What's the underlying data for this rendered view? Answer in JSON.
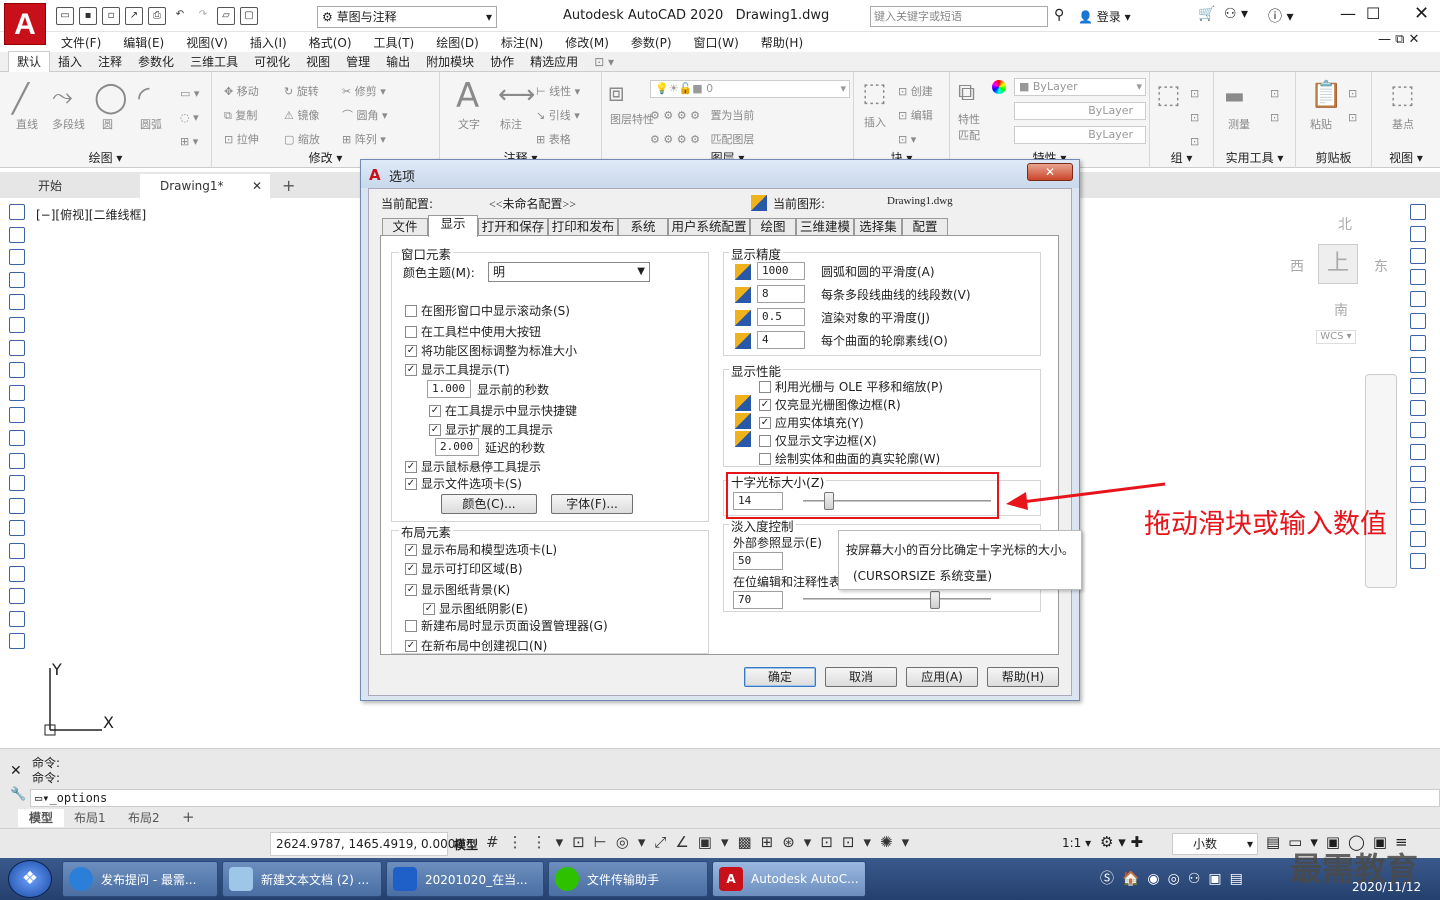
{
  "app": {
    "title": "Autodesk AutoCAD 2020",
    "doc": "Drawing1.dwg",
    "workspace": "草图与注释",
    "search_placeholder": "键入关键字或短语",
    "login": "登录"
  },
  "menu": [
    "文件(F)",
    "编辑(E)",
    "视图(V)",
    "插入(I)",
    "格式(O)",
    "工具(T)",
    "绘图(D)",
    "标注(N)",
    "修改(M)",
    "参数(P)",
    "窗口(W)",
    "帮助(H)"
  ],
  "ribbon_tabs": [
    "默认",
    "插入",
    "注释",
    "参数化",
    "三维工具",
    "可视化",
    "视图",
    "管理",
    "输出",
    "附加模块",
    "协作",
    "精选应用"
  ],
  "ribbon": {
    "draw_items": [
      "直线",
      "多段线",
      "圆",
      "圆弧"
    ],
    "modify_items": [
      "移动",
      "旋转",
      "修剪",
      "复制",
      "镜像",
      "圆角",
      "拉伸",
      "缩放",
      "阵列"
    ],
    "annot_items": [
      "文字",
      "标注",
      "线性",
      "引线",
      "表格"
    ],
    "layer_items": [
      "图层特性",
      "置为当前",
      "匹配图层",
      "0"
    ],
    "prop_items": [
      "ByLayer",
      "ByLayer",
      "ByLayer",
      "特性匹配"
    ],
    "insert_items": [
      "插入",
      "创建",
      "编辑"
    ],
    "panels": [
      "绘图",
      "修改",
      "注释",
      "图层",
      "块",
      "特性",
      "组",
      "实用工具",
      "剪贴板",
      "视图"
    ],
    "misc": [
      "测量",
      "粘贴",
      "基点"
    ]
  },
  "doctabs": {
    "start": "开始",
    "drawing": "Drawing1*"
  },
  "viewport_label": "[−][俯视][二维线框]",
  "viewcube": {
    "n": "北",
    "s": "南",
    "e": "东",
    "w": "西",
    "wcs": "WCS"
  },
  "ucs": {
    "x": "X",
    "y": "Y"
  },
  "dialog": {
    "title": "选项",
    "profile_label": "当前配置:",
    "profile_value": "<<未命名配置>>",
    "drawing_label": "当前图形:",
    "drawing_value": "Drawing1.dwg",
    "tabs": [
      "文件",
      "显示",
      "打开和保存",
      "打印和发布",
      "系统",
      "用户系统配置",
      "绘图",
      "三维建模",
      "选择集",
      "配置"
    ],
    "window_elements": {
      "title": "窗口元素",
      "theme_label": "颜色主题(M):",
      "theme_value": "明",
      "scrollbars": "在图形窗口中显示滚动条(S)",
      "large_buttons": "在工具栏中使用大按钮",
      "resize_icons": "将功能区图标调整为标准大小",
      "tooltips": "显示工具提示(T)",
      "tooltip_delay": "1.000",
      "tooltip_delay_label": "显示前的秒数",
      "shortcut_keys": "在工具提示中显示快捷键",
      "extended_tips": "显示扩展的工具提示",
      "ext_delay": "2.000",
      "ext_delay_label": "延迟的秒数",
      "rollover": "显示鼠标悬停工具提示",
      "file_tabs": "显示文件选项卡(S)",
      "colors_btn": "颜色(C)...",
      "fonts_btn": "字体(F)..."
    },
    "layout_elements": {
      "title": "布局元素",
      "items": [
        "显示布局和模型选项卡(L)",
        "显示可打印区域(B)",
        "显示图纸背景(K)",
        "显示图纸阴影(E)",
        "新建布局时显示页面设置管理器(G)",
        "在新布局中创建视口(N)"
      ],
      "checked": [
        true,
        true,
        true,
        true,
        false,
        true
      ]
    },
    "resolution": {
      "title": "显示精度",
      "rows": [
        {
          "value": "1000",
          "label": "圆弧和圆的平滑度(A)"
        },
        {
          "value": "8",
          "label": "每条多段线曲线的线段数(V)"
        },
        {
          "value": "0.5",
          "label": "渲染对象的平滑度(J)"
        },
        {
          "value": "4",
          "label": "每个曲面的轮廓素线(O)"
        }
      ]
    },
    "performance": {
      "title": "显示性能",
      "items": [
        "利用光栅与 OLE 平移和缩放(P)",
        "仅亮显光栅图像边框(R)",
        "应用实体填充(Y)",
        "仅显示文字边框(X)",
        "绘制实体和曲面的真实轮廓(W)"
      ],
      "checked": [
        false,
        true,
        true,
        false,
        false
      ]
    },
    "crosshair": {
      "title": "十字光标大小(Z)",
      "value": "14",
      "level": 0.14
    },
    "fade": {
      "title": "淡入度控制",
      "xref_label": "外部参照显示(E)",
      "xref_value": "50",
      "inplace_label": "在位编辑和注释性表",
      "inplace_value": "70",
      "inplace_level": 0.7
    },
    "tooltip": {
      "line1": "按屏幕大小的百分比确定十字光标的大小。",
      "line2": "(CURSORSIZE 系统变量)"
    },
    "buttons": {
      "ok": "确定",
      "cancel": "取消",
      "apply": "应用(A)",
      "help": "帮助(H)"
    }
  },
  "annotation": {
    "text": "拖动滑块或输入数值",
    "color": "#e8141b"
  },
  "command": {
    "line1": "命令:",
    "line2": "命令:",
    "input": "_options"
  },
  "layout_tabs": [
    "模型",
    "布局1",
    "布局2"
  ],
  "status": {
    "coords": "2624.9787, 1465.4919, 0.0000",
    "model": "模型",
    "scale": "1:1",
    "units": "小数"
  },
  "taskbar": {
    "items": [
      "发布提问 - 最需...",
      "新建文本文档 (2) ...",
      "20201020_在当...",
      "文件传输助手",
      "Autodesk AutoC..."
    ],
    "date": "2020/11/12",
    "watermark": "最需教育"
  }
}
